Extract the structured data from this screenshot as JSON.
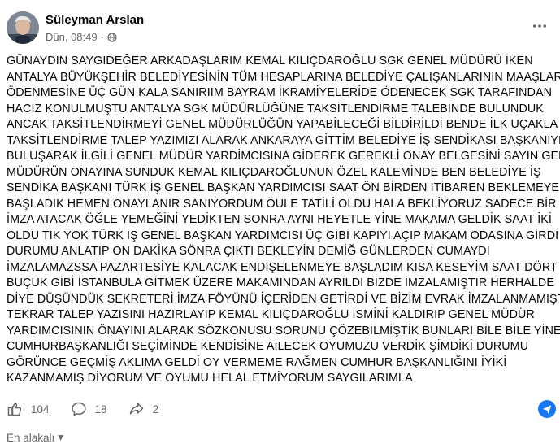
{
  "post": {
    "author_name": "Süleyman Arslan",
    "timestamp": "Dün, 08:49",
    "privacy_icon": "globe-icon",
    "more_icon": "more-horizontal-icon",
    "text_lines": [
      "GÜNAYDIN SAYGIDEĞER ARKADAŞLARIM KEMAL KILIÇDAROĞLU SGK GENEL MÜDÜRÜ İKEN",
      "ANTALYA BÜYÜKŞEHİR BELEDİYESİNİN TÜM HESAPLARINA BELEDİYE ÇALIŞANLARININ MAAŞLARININ",
      "ÖDENMESİNE ÜÇ GÜN KALA  SANIRIIM  BAYRAM İKRAMİYELERİDE ÖDENECEK  SGK TARAFINDAN",
      "HACİZ KONULMUŞTU ANTALYA SGK MÜDÜRLÜĞÜNE TAKSİTLENDİRME TALEBİNDE BULUNDUK",
      "ANCAK TAKSİTLENDİRMEYİ GENEL MÜDÜRLÜĞÜN YAPABİLECEĞİ BİLDİRİLDİ BENDE İLK UÇAKLA",
      "TAKSİTLENDİRME TALEP YAZIMIZI ALARAK ANKARAYA GİTTİM BELEDİYE İŞ SENDİKASI BAŞKANIYLA",
      "BULUŞARAK İLGİLİ GENEL MÜDÜR YARDİMCISINA GİDEREK GEREKLİ ONAY BELGESİNİ SAYIN GENEL",
      "MÜDÜRÜN ONAYINA SUNDUK KEMAL KILIÇDAROĞLUNUN ÖZEL KALEMİNDE BEN BELEDİYE İŞ",
      "SENDİKA BAŞKANI TÜRK İŞ GENEL BAŞKAN YARDIMCISI SAAT ÖN BİRDEN İTİBAREN BEKLEMEYE",
      "BAŞLADIK HEMEN ONAYLANIR SANIYORDUM ÖULE TATİLİ OLDU HALA BEKLİYORUZ SADECE BİR",
      "İMZA ATACAK ÖĞLE YEMEĞİNİ YEDİKTEN SONRA AYNI HEYETLE YİNE MAKAMA GELDİK SAAT İKİ",
      "OLDU TIK YOK TÜRK İŞ GENEL BAŞKAN YARDIMCISI ÜÇ GİBİ KAPIYI AÇIP MAKAM ODASINA GİRDİ",
      "DURUMU ANLATIP ON DAKİKA SÖNRA ÇIKTI BEKLEYİN DEMİĞ GÜNLERDEN CUMAYDI",
      "İMZALAMAZSSA PAZARTESİYE KALACAK ENDİŞELENMEYE BAŞLADIM KISA KESEYİM SAAT DÖRT",
      "BUÇUK GİBİ İSTANBULA GİTMEK ÜZERE MAKAMINDAN AYRILDI BİZDE İMZALAMIŞTIR HERHALDE",
      "DİYE DÜŞÜNDÜK SEKRETERİ İMZA FÖYÜNÜ İÇERİDEN GETİRDİ VE BİZİM EVRAK İMZALANMAMIŞTI",
      "TEKRAR TALEP YAZISINI HAZIRLAYIP KEMAL KILIÇDAROĞLU İSMİNİ KALDIRIP GENEL MÜDÜR",
      "YARDIMCISININ ÖNAYINI ALARAK SÖZKONUSU SORUNU ÇÖZEBİLMİŞTİK BUNLARI BİLE BİLE YİNEDE",
      "CUMHURBAŞKANLIĞI SEÇİMİNDE KENDİSİNE AİLECEK OYUMUZU VERDİK ŞİMDİKİ DURUMU",
      "GÖRÜNCE GEÇMİŞ AKLIMA GELDİ OY VERMEME RAĞMEN CUMHUR BAŞKANLIĞINI İYİKİ",
      "KAZANMAMIŞ DİYORUM  VE OYUMU HELAL ETMİYORUM SAYGILARIMLA"
    ]
  },
  "actions": {
    "like_count": "104",
    "comment_count": "18",
    "share_count": "2",
    "like_icon": "thumbs-up-icon",
    "comment_icon": "comment-bubble-icon",
    "share_icon": "share-arrow-icon",
    "send_icon": "send-icon"
  },
  "comments": {
    "sort_label": "En alakalı"
  },
  "colors": {
    "accent": "#1877f2",
    "text": "#050505",
    "secondary_text": "#65676b"
  }
}
